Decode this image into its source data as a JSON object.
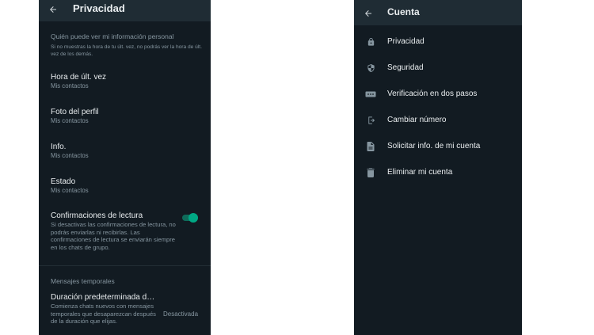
{
  "privacy": {
    "title": "Privacidad",
    "section_visibility": "Quién puede ver mi información personal",
    "section_visibility_desc": "Si no muestras la hora de tu últ. vez, no podrás ver la hora de últ. vez de los demás.",
    "items": [
      {
        "label": "Hora de últ. vez",
        "value": "Mis contactos"
      },
      {
        "label": "Foto del perfil",
        "value": "Mis contactos"
      },
      {
        "label": "Info.",
        "value": "Mis contactos"
      },
      {
        "label": "Estado",
        "value": "Mis contactos"
      }
    ],
    "read_receipts": {
      "label": "Confirmaciones de lectura",
      "desc": "Si desactivas las confirmaciones de lectura, no podrás enviarlas ni recibirlas. Las confirmaciones de lectura se enviarán siempre en los chats de grupo.",
      "enabled": true
    },
    "section_temporary": "Mensajes temporales",
    "default_duration": {
      "label": "Duración predeterminada de...",
      "desc": "Comienza chats nuevos con mensajes temporales que desaparezcan después de la duración que elijas.",
      "value": "Desactivada"
    }
  },
  "account": {
    "title": "Cuenta",
    "items": [
      {
        "label": "Privacidad",
        "icon": "lock-icon"
      },
      {
        "label": "Seguridad",
        "icon": "shield-icon"
      },
      {
        "label": "Verificación en dos pasos",
        "icon": "dots-password-icon"
      },
      {
        "label": "Cambiar número",
        "icon": "change-number-icon"
      },
      {
        "label": "Solicitar info. de mi cuenta",
        "icon": "document-icon"
      },
      {
        "label": "Eliminar mi cuenta",
        "icon": "trash-icon"
      }
    ]
  },
  "colors": {
    "background": "#121b22",
    "appbar": "#1f2c34",
    "accent": "#00a884",
    "text_primary": "#e9edef",
    "text_secondary": "#8696a0"
  }
}
